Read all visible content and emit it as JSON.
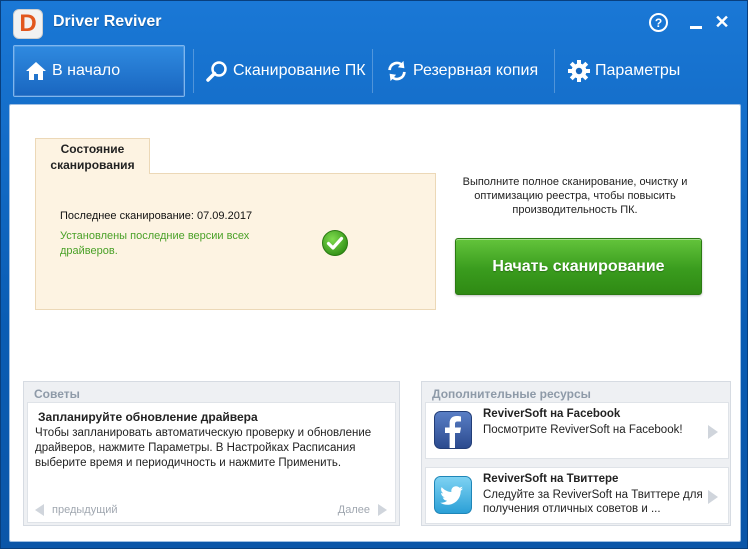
{
  "app": {
    "title": "Driver Reviver",
    "logo_letter": "D"
  },
  "window_controls": {
    "help": "?",
    "close": "✕"
  },
  "nav": {
    "items": [
      {
        "label": "В начало",
        "icon": "home-icon",
        "active": true
      },
      {
        "label": "Сканирование ПК",
        "icon": "search-icon",
        "active": false
      },
      {
        "label": "Резервная копия",
        "icon": "refresh-icon",
        "active": false
      },
      {
        "label": "Параметры",
        "icon": "gear-icon",
        "active": false
      }
    ]
  },
  "status": {
    "tab_label": "Состояние сканирования",
    "last_scan": "Последнее сканирование: 07.09.2017",
    "drivers_status": "Установлены последние версии всех драйверов."
  },
  "promo": {
    "text": "Выполните полное сканирование, очистку и оптимизацию реестра, чтобы повысить производительность ПК.",
    "scan_button": "Начать сканирование"
  },
  "tips": {
    "header": "Советы",
    "title": "Запланируйте обновление драйвера",
    "body": "Чтобы запланировать автоматическую проверку и обновление драйверов, нажмите Параметры. В Настройках Расписания выберите время и периодичность и нажмите Применить.",
    "prev": "предыдущий",
    "next": "Далее"
  },
  "resources": {
    "header": "Дополнительные ресурсы",
    "items": [
      {
        "title": "ReviverSoft на Facebook",
        "desc": "Посмотрите ReviverSoft на Facebook!",
        "icon": "facebook-icon"
      },
      {
        "title": "ReviverSoft на Твиттере",
        "desc": "Следуйте за ReviverSoft на Твиттере для получения отличных советов и ...",
        "icon": "twitter-icon"
      }
    ]
  },
  "colors": {
    "titlebar_blue": "#1a78d6",
    "scan_green": "#3a9c1e",
    "status_bg": "#fdf3e2",
    "ok_green": "#4aa128"
  }
}
